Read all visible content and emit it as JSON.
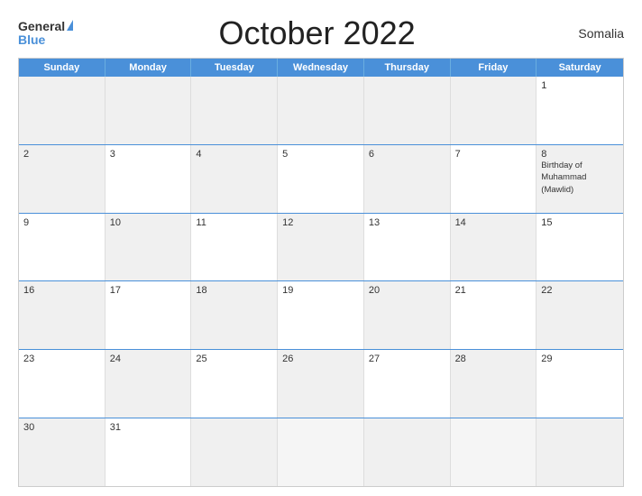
{
  "header": {
    "logo_general": "General",
    "logo_blue": "Blue",
    "title": "October 2022",
    "country": "Somalia"
  },
  "calendar": {
    "days_of_week": [
      "Sunday",
      "Monday",
      "Tuesday",
      "Wednesday",
      "Thursday",
      "Friday",
      "Saturday"
    ],
    "rows": [
      [
        {
          "day": "",
          "empty": true
        },
        {
          "day": "",
          "empty": true
        },
        {
          "day": "",
          "empty": true
        },
        {
          "day": "",
          "empty": true
        },
        {
          "day": "",
          "empty": true
        },
        {
          "day": "",
          "empty": true
        },
        {
          "day": "1",
          "event": ""
        }
      ],
      [
        {
          "day": "2",
          "event": ""
        },
        {
          "day": "3",
          "event": ""
        },
        {
          "day": "4",
          "event": ""
        },
        {
          "day": "5",
          "event": ""
        },
        {
          "day": "6",
          "event": ""
        },
        {
          "day": "7",
          "event": ""
        },
        {
          "day": "8",
          "event": "Birthday of Muhammad (Mawlid)"
        }
      ],
      [
        {
          "day": "9",
          "event": ""
        },
        {
          "day": "10",
          "event": ""
        },
        {
          "day": "11",
          "event": ""
        },
        {
          "day": "12",
          "event": ""
        },
        {
          "day": "13",
          "event": ""
        },
        {
          "day": "14",
          "event": ""
        },
        {
          "day": "15",
          "event": ""
        }
      ],
      [
        {
          "day": "16",
          "event": ""
        },
        {
          "day": "17",
          "event": ""
        },
        {
          "day": "18",
          "event": ""
        },
        {
          "day": "19",
          "event": ""
        },
        {
          "day": "20",
          "event": ""
        },
        {
          "day": "21",
          "event": ""
        },
        {
          "day": "22",
          "event": ""
        }
      ],
      [
        {
          "day": "23",
          "event": ""
        },
        {
          "day": "24",
          "event": ""
        },
        {
          "day": "25",
          "event": ""
        },
        {
          "day": "26",
          "event": ""
        },
        {
          "day": "27",
          "event": ""
        },
        {
          "day": "28",
          "event": ""
        },
        {
          "day": "29",
          "event": ""
        }
      ],
      [
        {
          "day": "30",
          "event": ""
        },
        {
          "day": "31",
          "event": ""
        },
        {
          "day": "",
          "empty": true
        },
        {
          "day": "",
          "empty": true
        },
        {
          "day": "",
          "empty": true
        },
        {
          "day": "",
          "empty": true
        },
        {
          "day": "",
          "empty": true
        }
      ]
    ]
  }
}
